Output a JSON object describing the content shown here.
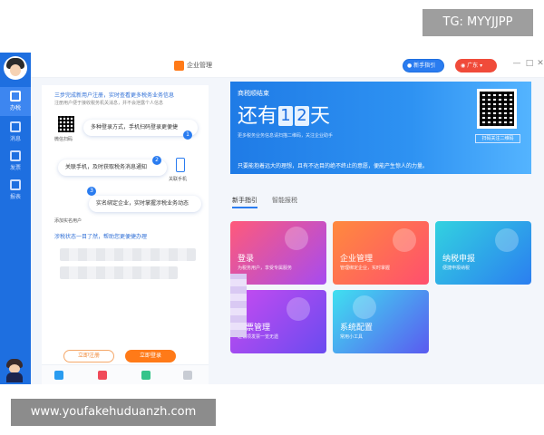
{
  "watermarks": {
    "top": "TG: MYYJJPP",
    "bottom": "www.youfakehuduanzh.com"
  },
  "titlebar": {
    "app_title": "企业管理",
    "guide_label": "新手指引",
    "region_label": "广东",
    "minimize": "—",
    "maximize": "□",
    "close": "✕"
  },
  "sidebar": {
    "items": [
      {
        "label": "办税",
        "icon": "home-icon"
      },
      {
        "label": "消息",
        "icon": "message-icon"
      },
      {
        "label": "发票",
        "icon": "invoice-icon"
      },
      {
        "label": "报表",
        "icon": "chart-icon"
      }
    ]
  },
  "left_panel": {
    "tip_top": "三步完成新用户注册，实时查看更多税务业务信息",
    "tip_sub": "注册用户便于接收税务机关消息，并不会泄露个人信息",
    "qr_label": "微信扫码",
    "step1": "多种登录方式，手机扫码登录更便捷",
    "step2": "关联手机，及时获取税务消息通知",
    "phone_label": "关联手机",
    "step3": "实名绑定企业，实时掌握涉税业务动态",
    "add_user_label": "添加实名用户",
    "tip_bottom": "涉税状态一目了然，帮助您更便捷办理",
    "btn_register": "立即注册",
    "btn_login": "立即登录"
  },
  "banner": {
    "subtitle": "商税顺结束",
    "prefix": "还有",
    "digit1": "1",
    "digit2": "2",
    "suffix": "天",
    "note": "更多税务业务信息请扫描二维码，关注企业助手",
    "motto": "只要能抱着远大的理想，且有不达目的绝不终止的意愿，便能产生惊人的力量。",
    "qr_caption": "扫码关注二维码"
  },
  "tabs": [
    {
      "label": "新手指引",
      "active": true
    },
    {
      "label": "智能报税",
      "active": false
    }
  ],
  "cards": [
    {
      "title": "登录",
      "subtitle": "为税务用户，享受专属服务",
      "colors": [
        "#ff5a7a",
        "#a64bf0"
      ]
    },
    {
      "title": "企业管理",
      "subtitle": "管理绑定企业，实时掌握",
      "colors": [
        "#ff8a3d",
        "#ff4f6e"
      ]
    },
    {
      "title": "纳税申报",
      "subtitle": "便捷申报纳税",
      "colors": [
        "#32d2e0",
        "#2b7ef0"
      ]
    },
    {
      "title": "发票管理",
      "subtitle": "进销项发票一览无遗",
      "colors": [
        "#c84bf0",
        "#6a4bf0"
      ]
    },
    {
      "title": "系统配置",
      "subtitle": "常用小工具",
      "colors": [
        "#3fe0f0",
        "#5a5af0"
      ]
    }
  ]
}
